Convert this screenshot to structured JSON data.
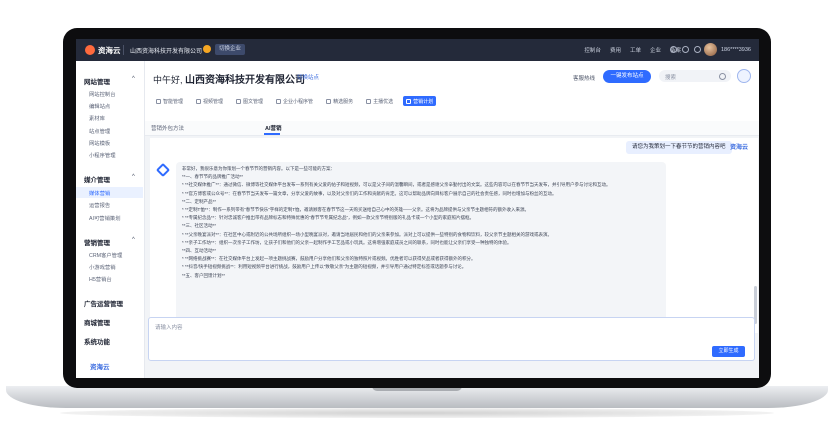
{
  "topbar": {
    "brand": "资海云",
    "company": "山西资海科技开发有限公司",
    "switch_enterprise": "切换企业",
    "nav": [
      "控制台",
      "费用",
      "工单",
      "企业",
      "备案"
    ],
    "phone": "186****3936"
  },
  "sidebar": {
    "groups": [
      {
        "title": "网站管理",
        "items": [
          "网站控制台",
          "编辑站点",
          "素材库",
          "站点管理",
          "网站模板",
          "小程序管理"
        ]
      },
      {
        "title": "媒介管理",
        "items": [
          "媒体营销",
          "运营报告",
          "AI可营销策划"
        ]
      },
      {
        "title": "营销管理",
        "items": [
          "CRM客户管理",
          "小游戏营销",
          "H5营销台"
        ]
      },
      {
        "title": "广告运营管理",
        "items": []
      },
      {
        "title": "商城管理",
        "items": []
      },
      {
        "title": "系统功能",
        "items": []
      }
    ],
    "active_item": "媒体营销",
    "footer_logo": "资海云"
  },
  "header": {
    "greeting": "中午好,",
    "company": "山西资海科技开发有限公司",
    "switch_site": "切换站点",
    "help": "客服热线",
    "publish_button": "一键发布站点",
    "search_placeholder": "搜索",
    "modules": [
      "智能管理",
      "视频管理",
      "图文管理",
      "企业小程序管",
      "精选服务",
      "主播优选",
      "营销计划"
    ]
  },
  "tabs": [
    "营销外包方法",
    "AI营销"
  ],
  "chat": {
    "user_message": "请您为我策划一下春节节的营销内容吧",
    "user_logo": "资海云",
    "answer_lines": [
      "非常好，我很乐意为你策划一个春节节的营销内容。以下是一些可能的方案：",
      "**一、春节节的品牌推广活动**",
      "* **社交媒体推广**：通过微信、微博等社交媒体平台发布一系列有关父爱的帖子和短视频，可以是父子间的温馨瞬间，或者是感谢父亲辛勤付出的文案。这些内容可以在春节节当天发布，并引导用户参与讨论和互动。",
      "* **官方博客或公众号**：在春节节当天发布一篇文章，分享父爱的故事，以及对父亲们的工作和贡献的肯定。这可以帮助品牌向目标客户展示自己的社会责任感，同时也增加与粉丝的互动。",
      "**二、定制产品**",
      "* **定制T恤**：制作一系列带有“春节节快乐”字样的定制T恤，邀请顾客在春节节这一天购买送给自己心中的英雄——父亲。这将为品牌提供与父亲节主题相符的额外收入来源。",
      "* **专属纪念品**：针对忠诚客户推出带有品牌标志和特殊优惠的“春节节专属纪念品”，例如一款父亲节特别版的礼品卡或一个小型的家庭照片摆框。",
      "**三、社区活动**",
      "* **父亲晚宴派对**：在社区中心或附近的公共场所组织一场小型晚宴派对，邀请当地居民和他们的父亲来参加。派对上可以提供一些特别的食物和饮料，较父亲节主题相关的游戏或表演。",
      "* **亲子工作坊**：组织一次亲子工作坊，让孩子们和他们的父亲一起制作手工艺品或小玩具。这将增强家庭成员之间的联系，同时也能让父亲们享受一种独特的体验。",
      "**四、互动活动**",
      "* **网络挑战赛**：在社交媒体平台上发起一项主题挑战赛，鼓励用户分享他们和父亲的独特照片或视频。优胜者可以获得奖品或者获得额外的积分。",
      "* **抖音/快手短视频挑战**：利用短视频平台进行挑战，鼓励用户上传以“致敬父亲”为主题的短视频，并引导用户通过特定标签或话题参与讨论。",
      "**五、客户回馈计划**"
    ]
  },
  "input": {
    "placeholder": "请输入内容",
    "generate_button": "立即生成"
  }
}
